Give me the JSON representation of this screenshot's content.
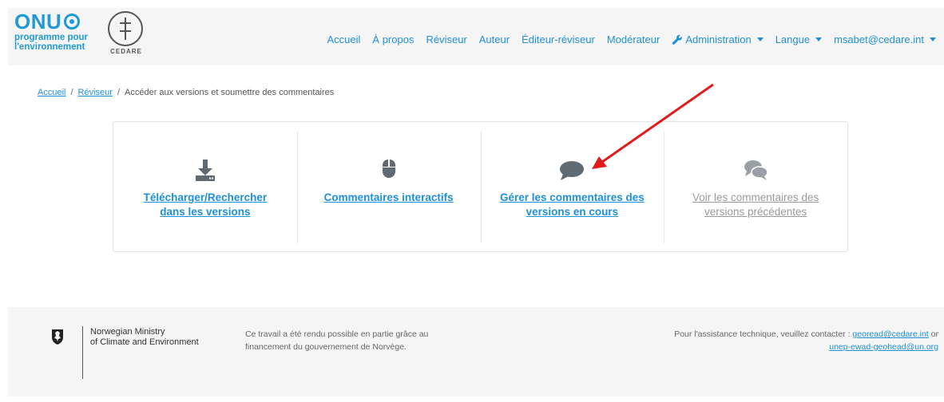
{
  "header": {
    "logo_text": "ONU",
    "logo_sub1": "programme pour",
    "logo_sub2": "l'environnement",
    "cedare_text": "CEDARE"
  },
  "nav": {
    "items": [
      "Accueil",
      "À propos",
      "Réviseur",
      "Auteur",
      "Éditeur-réviseur",
      "Modérateur"
    ],
    "admin": "Administration",
    "language": "Langue",
    "user": "msabet@cedare.int"
  },
  "breadcrumb": {
    "home": "Accueil",
    "reviewer": "Réviseur",
    "separator": "/",
    "current": "Accéder aux versions et soumettre des commentaires"
  },
  "cards": [
    {
      "icon": "download-icon",
      "label": "Télécharger/Rechercher dans les versions",
      "enabled": true
    },
    {
      "icon": "mouse-icon",
      "label": "Commentaires interactifs",
      "enabled": true
    },
    {
      "icon": "comment-icon",
      "label": "Gérer les commentaires des versions en cours",
      "enabled": true
    },
    {
      "icon": "comments-icon",
      "label": "Voir les commentaires des versions précédentes",
      "enabled": false
    }
  ],
  "footer": {
    "ministry_line1": "Norwegian Ministry",
    "ministry_line2": "of Climate and Environment",
    "credit": "Ce travail a été rendu possible en partie grâce au financement du gouvernement de Norvège.",
    "contact_text": "Pour l'assistance technique, veuillez contacter :",
    "contact_email1": "georead@cedare.int",
    "contact_or": "or",
    "contact_email2": "unep-ewad-geohead@un.org"
  },
  "colors": {
    "link": "#1f8fd6",
    "icon": "#5f6a72",
    "disabled": "#999999",
    "annotation_arrow": "#e11b1b"
  }
}
